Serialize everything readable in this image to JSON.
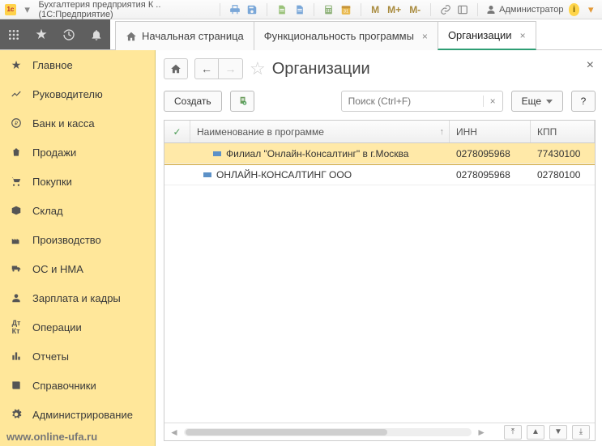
{
  "titlebar": {
    "app_label": "Бухгалтерия предприятия К .. (1С:Предприятие)",
    "M1": "M",
    "M2": "M+",
    "M3": "M-",
    "user_label": "Администратор"
  },
  "tabs": [
    {
      "label": "Начальная страница",
      "closable": false,
      "home": true,
      "active": false
    },
    {
      "label": "Функциональность программы",
      "closable": true,
      "home": false,
      "active": false
    },
    {
      "label": "Организации",
      "closable": true,
      "home": false,
      "active": true
    }
  ],
  "sidebar": {
    "items": [
      {
        "label": "Главное",
        "icon": "star"
      },
      {
        "label": "Руководителю",
        "icon": "trend"
      },
      {
        "label": "Банк и касса",
        "icon": "ruble"
      },
      {
        "label": "Продажи",
        "icon": "bag"
      },
      {
        "label": "Покупки",
        "icon": "cart"
      },
      {
        "label": "Склад",
        "icon": "box"
      },
      {
        "label": "Производство",
        "icon": "factory"
      },
      {
        "label": "ОС и НМА",
        "icon": "truck"
      },
      {
        "label": "Зарплата и кадры",
        "icon": "person"
      },
      {
        "label": "Операции",
        "icon": "ops"
      },
      {
        "label": "Отчеты",
        "icon": "chart"
      },
      {
        "label": "Справочники",
        "icon": "book"
      },
      {
        "label": "Администрирование",
        "icon": "gear"
      }
    ],
    "footer_url": "www.online-ufa.ru"
  },
  "page": {
    "title": "Организации",
    "create_label": "Создать",
    "more_label": "Еще",
    "help_label": "?",
    "search_placeholder": "Поиск (Ctrl+F)"
  },
  "table": {
    "columns": {
      "check": "✓",
      "name": "Наименование в программе",
      "inn": "ИНН",
      "kpp": "КПП"
    },
    "rows": [
      {
        "name": "Филиал \"Онлайн-Консалтинг\" в г.Москва",
        "inn": "0278095968",
        "kpp": "77430100",
        "selected": true
      },
      {
        "name": "ОНЛАЙН-КОНСАЛТИНГ ООО",
        "inn": "0278095968",
        "kpp": "02780100",
        "selected": false
      }
    ]
  }
}
